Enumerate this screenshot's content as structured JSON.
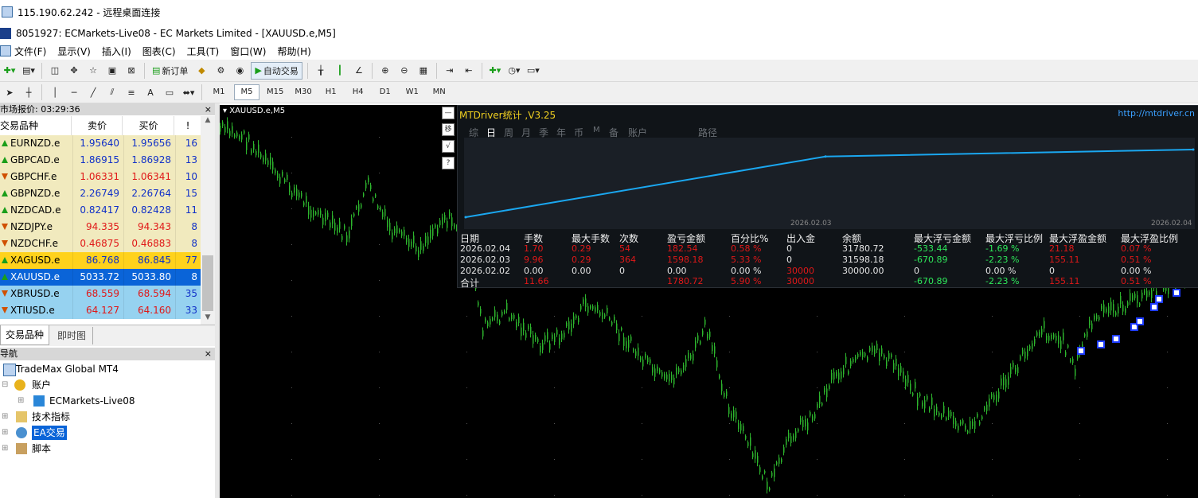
{
  "window": {
    "rdp_title": "115.190.62.242 - 远程桌面连接",
    "app_title": "8051927: ECMarkets-Live08 - EC Markets Limited - [XAUUSD.e,M5]"
  },
  "menu": [
    "文件(F)",
    "显示(V)",
    "插入(I)",
    "图表(C)",
    "工具(T)",
    "窗口(W)",
    "帮助(H)"
  ],
  "toolbar": {
    "new_order": "新订单",
    "auto_trade": "自动交易",
    "timeframes": [
      "M1",
      "M5",
      "M15",
      "M30",
      "H1",
      "H4",
      "D1",
      "W1",
      "MN"
    ],
    "active_timeframe": "M5",
    "text_tool": "A"
  },
  "market_watch": {
    "title": "市场报价: 03:29:36",
    "headers": {
      "symbol": "交易品种",
      "bid": "卖价",
      "ask": "买价",
      "spread": "!"
    },
    "rows": [
      {
        "symbol": "EURNZD.e",
        "bid": "1.95640",
        "ask": "1.95656",
        "spread": "16",
        "dir": "up"
      },
      {
        "symbol": "GBPCAD.e",
        "bid": "1.86915",
        "ask": "1.86928",
        "spread": "13",
        "dir": "up"
      },
      {
        "symbol": "GBPCHF.e",
        "bid": "1.06331",
        "ask": "1.06341",
        "spread": "10",
        "dir": "down"
      },
      {
        "symbol": "GBPNZD.e",
        "bid": "2.26749",
        "ask": "2.26764",
        "spread": "15",
        "dir": "up"
      },
      {
        "symbol": "NZDCAD.e",
        "bid": "0.82417",
        "ask": "0.82428",
        "spread": "11",
        "dir": "up"
      },
      {
        "symbol": "NZDJPY.e",
        "bid": "94.335",
        "ask": "94.343",
        "spread": "8",
        "dir": "down"
      },
      {
        "symbol": "NZDCHF.e",
        "bid": "0.46875",
        "ask": "0.46883",
        "spread": "8",
        "dir": "down"
      },
      {
        "symbol": "XAGUSD.e",
        "bid": "86.768",
        "ask": "86.845",
        "spread": "77",
        "dir": "up"
      },
      {
        "symbol": "XAUUSD.e",
        "bid": "5033.72",
        "ask": "5033.80",
        "spread": "8",
        "dir": "up"
      },
      {
        "symbol": "XBRUSD.e",
        "bid": "68.559",
        "ask": "68.594",
        "spread": "35",
        "dir": "down"
      },
      {
        "symbol": "XTIUSD.e",
        "bid": "64.127",
        "ask": "64.160",
        "spread": "33",
        "dir": "down"
      }
    ],
    "tabs": [
      "交易品种",
      "即时图"
    ]
  },
  "navigator": {
    "title": "导航",
    "root": "TradeMax Global MT4",
    "accounts": "账户",
    "account_item": "ECMarkets-Live08",
    "indicators": "技术指标",
    "ea": "EA交易",
    "scripts": "脚本"
  },
  "chart": {
    "label": "XAUUSD.e,M5",
    "candle_color": "#2db52d"
  },
  "stats_panel": {
    "title": "MTDriver统计 ,V3.25",
    "url": "http://mtdriver.cn",
    "tabs": [
      "综",
      "日",
      "周",
      "月",
      "季",
      "年",
      "币",
      "M",
      "备",
      "账户",
      "路径"
    ],
    "active_tab": "日",
    "side_buttons": [
      "—",
      "移",
      "√",
      "?"
    ],
    "date_start": "2026.02.03",
    "date_end": "2026.02.04",
    "headers": [
      "日期",
      "手数",
      "最大手数",
      "次数",
      "盈亏金额",
      "百分比%",
      "出入金",
      "余额",
      "最大浮亏金额",
      "最大浮亏比例",
      "最大浮盈金额",
      "最大浮盈比例"
    ],
    "rows": [
      [
        "2026.02.04",
        "1.70",
        "0.29",
        "54",
        "182.54",
        "0.58 %",
        "0",
        "31780.72",
        "-533.44",
        "-1.69 %",
        "21.18",
        "0.07 %"
      ],
      [
        "2026.02.03",
        "9.96",
        "0.29",
        "364",
        "1598.18",
        "5.33 %",
        "0",
        "31598.18",
        "-670.89",
        "-2.23 %",
        "155.11",
        "0.51 %"
      ],
      [
        "2026.02.02",
        "0.00",
        "0.00",
        "0",
        "0.00",
        "0.00 %",
        "30000",
        "30000.00",
        "0",
        "0.00 %",
        "0",
        "0.00 %"
      ]
    ],
    "total": [
      "合计",
      "11.66",
      "",
      "",
      "1780.72",
      "5.90 %",
      "30000",
      "",
      "-670.89",
      "-2.23 %",
      "155.11",
      "0.51 %"
    ],
    "colors": {
      "red": "#e01818",
      "green": "#2ee85a",
      "text": "#e6e6e6",
      "line": "#1aa7f0"
    }
  },
  "chart_data": {
    "type": "line",
    "x": [
      "2026.02.02",
      "2026.02.03",
      "2026.02.04"
    ],
    "series": [
      {
        "values": [
          30000.0,
          31598.18,
          31780.72
        ]
      }
    ]
  }
}
